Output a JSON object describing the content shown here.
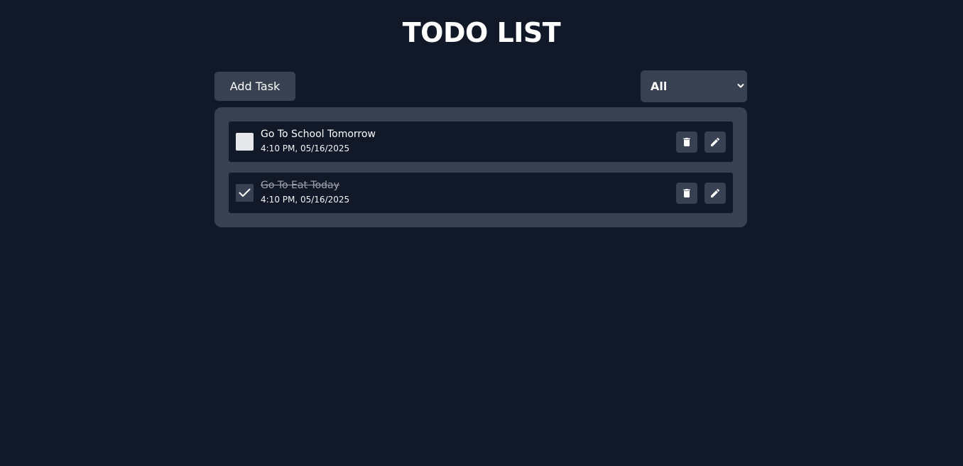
{
  "header": {
    "title": "TODO LIST"
  },
  "toolbar": {
    "add_label": "Add Task",
    "filter": {
      "selected": "All"
    }
  },
  "tasks": [
    {
      "title": "Go To School Tomorrow",
      "time": "4:10 PM, 05/16/2025",
      "completed": false
    },
    {
      "title": "Go To Eat Today",
      "time": "4:10 PM, 05/16/2025",
      "completed": true
    }
  ],
  "colors": {
    "background": "#111827",
    "panel": "#374151",
    "text": "#ffffff",
    "muted": "#9ca3af",
    "checkbox_unchecked": "#e5e7eb"
  },
  "icons": {
    "delete": "trash-icon",
    "edit": "pencil-icon",
    "check": "check-icon",
    "select": "chevron-down-icon"
  }
}
